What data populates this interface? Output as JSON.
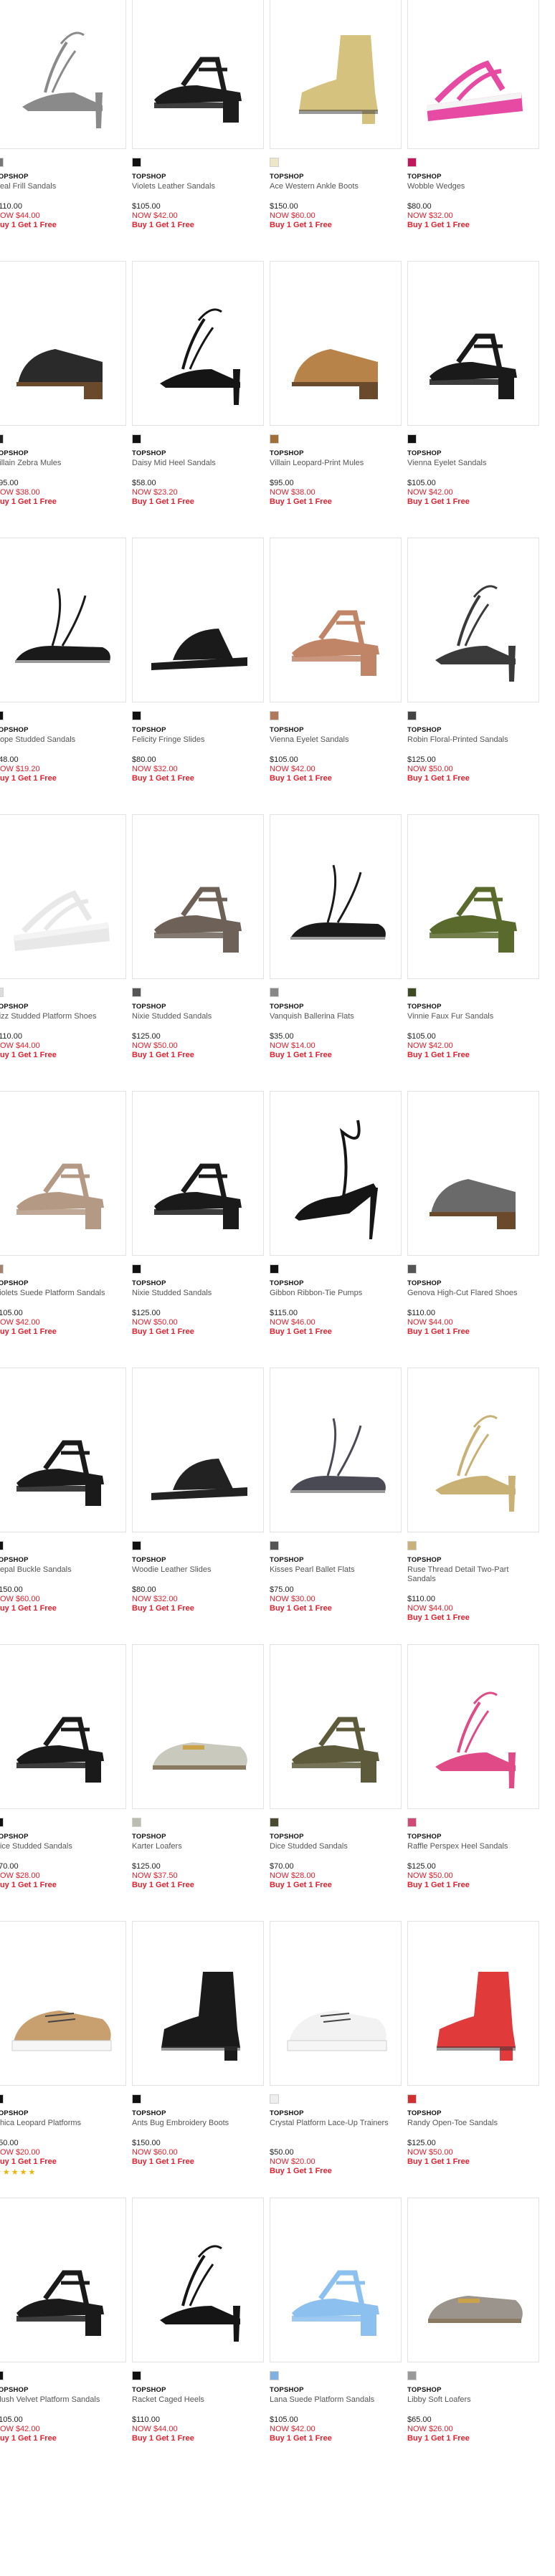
{
  "products": [
    {
      "brand": "TOPSHOP",
      "name": "Neal Frill Sandals",
      "price": "$110.00",
      "now": "NOW $44.00",
      "promo": "Buy 1 Get 1 Free",
      "swatch": "#777777",
      "shoe": "heel",
      "color": "#8a8a8a"
    },
    {
      "brand": "TOPSHOP",
      "name": "Violets Leather Sandals",
      "price": "$105.00",
      "now": "NOW $42.00",
      "promo": "Buy 1 Get 1 Free",
      "swatch": "#111111",
      "shoe": "block",
      "color": "#1c1c1c"
    },
    {
      "brand": "TOPSHOP",
      "name": "Ace Western Ankle Boots",
      "price": "$150.00",
      "now": "NOW $60.00",
      "promo": "Buy 1 Get 1 Free",
      "swatch": "#efe6c8",
      "shoe": "boot",
      "color": "#d6c27f"
    },
    {
      "brand": "TOPSHOP",
      "name": "Wobble Wedges",
      "price": "$80.00",
      "now": "NOW $32.00",
      "promo": "Buy 1 Get 1 Free",
      "swatch": "#c2185b",
      "shoe": "platform",
      "color": "#e64aa2"
    },
    {
      "brand": "TOPSHOP",
      "name": "Villain Zebra Mules",
      "price": "$95.00",
      "now": "NOW $38.00",
      "promo": "Buy 1 Get 1 Free",
      "swatch": "#222222",
      "shoe": "mule",
      "color": "#2a2a2a"
    },
    {
      "brand": "TOPSHOP",
      "name": "Daisy Mid Heel Sandals",
      "price": "$58.00",
      "now": "NOW $23.20",
      "promo": "Buy 1 Get 1 Free",
      "swatch": "#111111",
      "shoe": "heel",
      "color": "#151515"
    },
    {
      "brand": "TOPSHOP",
      "name": "Villain Leopard-Print Mules",
      "price": "$95.00",
      "now": "NOW $38.00",
      "promo": "Buy 1 Get 1 Free",
      "swatch": "#a0703a",
      "shoe": "mule",
      "color": "#b88348"
    },
    {
      "brand": "TOPSHOP",
      "name": "Vienna Eyelet Sandals",
      "price": "$105.00",
      "now": "NOW $42.00",
      "promo": "Buy 1 Get 1 Free",
      "swatch": "#111111",
      "shoe": "block",
      "color": "#1a1a1a"
    },
    {
      "brand": "TOPSHOP",
      "name": "Hope Studded Sandals",
      "price": "$48.00",
      "now": "NOW $19.20",
      "promo": "Buy 1 Get 1 Free",
      "swatch": "#111111",
      "shoe": "flat",
      "color": "#1a1a1a"
    },
    {
      "brand": "TOPSHOP",
      "name": "Felicity Fringe Slides",
      "price": "$80.00",
      "now": "NOW $32.00",
      "promo": "Buy 1 Get 1 Free",
      "swatch": "#111111",
      "shoe": "slide",
      "color": "#1a1a1a"
    },
    {
      "brand": "TOPSHOP",
      "name": "Vienna Eyelet Sandals",
      "price": "$105.00",
      "now": "NOW $42.00",
      "promo": "Buy 1 Get 1 Free",
      "swatch": "#b07a5a",
      "shoe": "block",
      "color": "#c08466"
    },
    {
      "brand": "TOPSHOP",
      "name": "Robin Floral-Printed Sandals",
      "price": "$125.00",
      "now": "NOW $50.00",
      "promo": "Buy 1 Get 1 Free",
      "swatch": "#444444",
      "shoe": "heel",
      "color": "#3a3a3a"
    },
    {
      "brand": "TOPSHOP",
      "name": "Fizz Studded Platform Shoes",
      "price": "$110.00",
      "now": "NOW $44.00",
      "promo": "Buy 1 Get 1 Free",
      "swatch": "#dcdcdc",
      "shoe": "platform",
      "color": "#e8e8e8"
    },
    {
      "brand": "TOPSHOP",
      "name": "Nixie Studded Sandals",
      "price": "$125.00",
      "now": "NOW $50.00",
      "promo": "Buy 1 Get 1 Free",
      "swatch": "#555555",
      "shoe": "block",
      "color": "#6e6258"
    },
    {
      "brand": "TOPSHOP",
      "name": "Vanquish Ballerina Flats",
      "price": "$35.00",
      "now": "NOW $14.00",
      "promo": "Buy 1 Get 1 Free",
      "swatch": "#888888",
      "shoe": "flat",
      "color": "#1a1a1a"
    },
    {
      "brand": "TOPSHOP",
      "name": "Vinnie Faux Fur Sandals",
      "price": "$105.00",
      "now": "NOW $42.00",
      "promo": "Buy 1 Get 1 Free",
      "swatch": "#3d4a22",
      "shoe": "block",
      "color": "#5a6a2c"
    },
    {
      "brand": "TOPSHOP",
      "name": "Violets Suede Platform Sandals",
      "price": "$105.00",
      "now": "NOW $42.00",
      "promo": "Buy 1 Get 1 Free",
      "swatch": "#a08470",
      "shoe": "block",
      "color": "#b49a84"
    },
    {
      "brand": "TOPSHOP",
      "name": "Nixie Studded Sandals",
      "price": "$125.00",
      "now": "NOW $50.00",
      "promo": "Buy 1 Get 1 Free",
      "swatch": "#111111",
      "shoe": "block",
      "color": "#1a1a1a"
    },
    {
      "brand": "TOPSHOP",
      "name": "Gibbon Ribbon-Tie Pumps",
      "price": "$115.00",
      "now": "NOW $46.00",
      "promo": "Buy 1 Get 1 Free",
      "swatch": "#111111",
      "shoe": "pump",
      "color": "#151515"
    },
    {
      "brand": "TOPSHOP",
      "name": "Genova High-Cut Flared Shoes",
      "price": "$110.00",
      "now": "NOW $44.00",
      "promo": "Buy 1 Get 1 Free",
      "swatch": "#555555",
      "shoe": "mule",
      "color": "#6a6a6a"
    },
    {
      "brand": "TOPSHOP",
      "name": "Nepal Buckle Sandals",
      "price": "$150.00",
      "now": "NOW $60.00",
      "promo": "Buy 1 Get 1 Free",
      "swatch": "#111111",
      "shoe": "block",
      "color": "#1a1a1a"
    },
    {
      "brand": "TOPSHOP",
      "name": "Woodie Leather Slides",
      "price": "$80.00",
      "now": "NOW $32.00",
      "promo": "Buy 1 Get 1 Free",
      "swatch": "#111111",
      "shoe": "slide",
      "color": "#222222"
    },
    {
      "brand": "TOPSHOP",
      "name": "Kisses Pearl Ballet Flats",
      "price": "$75.00",
      "now": "NOW $30.00",
      "promo": "Buy 1 Get 1 Free",
      "swatch": "#555555",
      "shoe": "flat",
      "color": "#4a4a55"
    },
    {
      "brand": "TOPSHOP",
      "name": "Ruse Thread Detail Two-Part Sandals",
      "price": "$110.00",
      "now": "NOW $44.00",
      "promo": "Buy 1 Get 1 Free",
      "swatch": "#c8b27a",
      "shoe": "heel",
      "color": "#c9b176"
    },
    {
      "brand": "TOPSHOP",
      "name": "Dice Studded Sandals",
      "price": "$70.00",
      "now": "NOW $28.00",
      "promo": "Buy 1 Get 1 Free",
      "swatch": "#111111",
      "shoe": "block",
      "color": "#1a1a1a"
    },
    {
      "brand": "TOPSHOP",
      "name": "Karter Loafers",
      "price": "$125.00",
      "now": "NOW $37.50",
      "promo": "Buy 1 Get 1 Free",
      "swatch": "#bcbcb0",
      "shoe": "loafer",
      "color": "#c9c9bd"
    },
    {
      "brand": "TOPSHOP",
      "name": "Dice Studded Sandals",
      "price": "$70.00",
      "now": "NOW $28.00",
      "promo": "Buy 1 Get 1 Free",
      "swatch": "#4a4a30",
      "shoe": "block",
      "color": "#5c5a3a"
    },
    {
      "brand": "TOPSHOP",
      "name": "Raffle Perspex Heel Sandals",
      "price": "$125.00",
      "now": "NOW $50.00",
      "promo": "Buy 1 Get 1 Free",
      "swatch": "#d04a78",
      "shoe": "heel",
      "color": "#e04a86"
    },
    {
      "brand": "TOPSHOP",
      "name": "Chica Leopard Platforms",
      "price": "$50.00",
      "now": "NOW $20.00",
      "promo": "Buy 1 Get 1 Free",
      "swatch": "#111111",
      "shoe": "sneaker",
      "color": "#c8a070",
      "stars": "★★★★★"
    },
    {
      "brand": "TOPSHOP",
      "name": "Ants Bug Embroidery Boots",
      "price": "$150.00",
      "now": "NOW $60.00",
      "promo": "Buy 1 Get 1 Free",
      "swatch": "#111111",
      "shoe": "boot",
      "color": "#1a1a1a"
    },
    {
      "brand": "TOPSHOP",
      "name": "Crystal Platform Lace-Up Trainers",
      "price": "$50.00",
      "now": "NOW $20.00",
      "promo": "Buy 1 Get 1 Free",
      "swatch": "#eeeeee",
      "shoe": "sneaker",
      "color": "#f2f2f2"
    },
    {
      "brand": "TOPSHOP",
      "name": "Randy Open-Toe Sandals",
      "price": "$125.00",
      "now": "NOW $50.00",
      "promo": "Buy 1 Get 1 Free",
      "swatch": "#d03030",
      "shoe": "boot",
      "color": "#e03a3a"
    },
    {
      "brand": "TOPSHOP",
      "name": "Plush Velvet Platform Sandals",
      "price": "$105.00",
      "now": "NOW $42.00",
      "promo": "Buy 1 Get 1 Free",
      "swatch": "#111111",
      "shoe": "block",
      "color": "#1a1a1a"
    },
    {
      "brand": "TOPSHOP",
      "name": "Racket Caged Heels",
      "price": "$110.00",
      "now": "NOW $44.00",
      "promo": "Buy 1 Get 1 Free",
      "swatch": "#111111",
      "shoe": "heel",
      "color": "#151515"
    },
    {
      "brand": "TOPSHOP",
      "name": "Lana Suede Platform Sandals",
      "price": "$105.00",
      "now": "NOW $42.00",
      "promo": "Buy 1 Get 1 Free",
      "swatch": "#7fb0e0",
      "shoe": "block",
      "color": "#8cc0ee"
    },
    {
      "brand": "TOPSHOP",
      "name": "Libby Soft Loafers",
      "price": "$65.00",
      "now": "NOW $26.00",
      "promo": "Buy 1 Get 1 Free",
      "swatch": "#999999",
      "shoe": "loafer",
      "color": "#9a948c"
    }
  ]
}
